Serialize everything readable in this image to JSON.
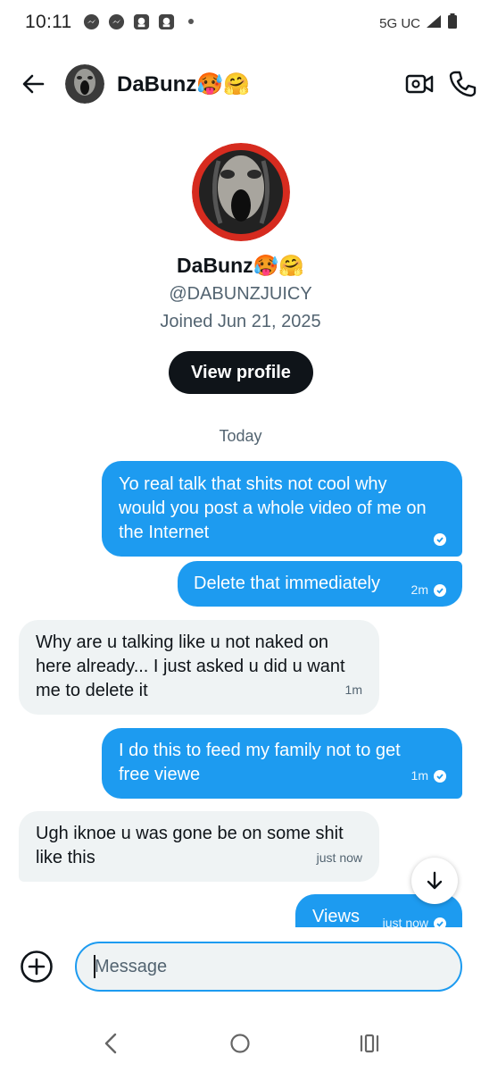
{
  "status_bar": {
    "time": "10:11",
    "network": "5G UC",
    "icons": [
      "messenger-icon",
      "messenger-icon",
      "app-icon",
      "app-icon",
      "dot-icon"
    ]
  },
  "header": {
    "name": "DaBunz🥵🤗",
    "icons": [
      "back-arrow-icon",
      "video-call-icon",
      "phone-icon"
    ]
  },
  "profile": {
    "name": "DaBunz🥵🤗",
    "handle": "@DABUNZJUICY",
    "joined": "Joined Jun 21, 2025",
    "view_profile_label": "View profile"
  },
  "day_label": "Today",
  "messages": [
    {
      "direction": "out",
      "lines": [
        "Yo real talk that shits not cool why",
        "would you post a whole video of me on",
        "the Internet"
      ],
      "time": ""
    },
    {
      "direction": "out",
      "lines": [
        "Delete that immediately"
      ],
      "time": "2m"
    },
    {
      "direction": "in",
      "lines": [
        "Why are u talking like u not naked on",
        "here already... I just asked u did u want",
        "me to delete it"
      ],
      "time": "1m"
    },
    {
      "direction": "out",
      "lines": [
        "I do this to feed my family not to get",
        "free viewe"
      ],
      "time": "1m"
    },
    {
      "direction": "in",
      "lines": [
        "Ugh iknoe u was gone be on some shit",
        "like this"
      ],
      "time": "just now"
    },
    {
      "direction": "out",
      "lines": [
        "Views"
      ],
      "time": "just now"
    }
  ],
  "composer": {
    "placeholder": "Message"
  },
  "colors": {
    "accent": "#1d9bf0",
    "incoming_bubble": "#eff3f4",
    "text": "#0f1419",
    "secondary_text": "#536471"
  }
}
